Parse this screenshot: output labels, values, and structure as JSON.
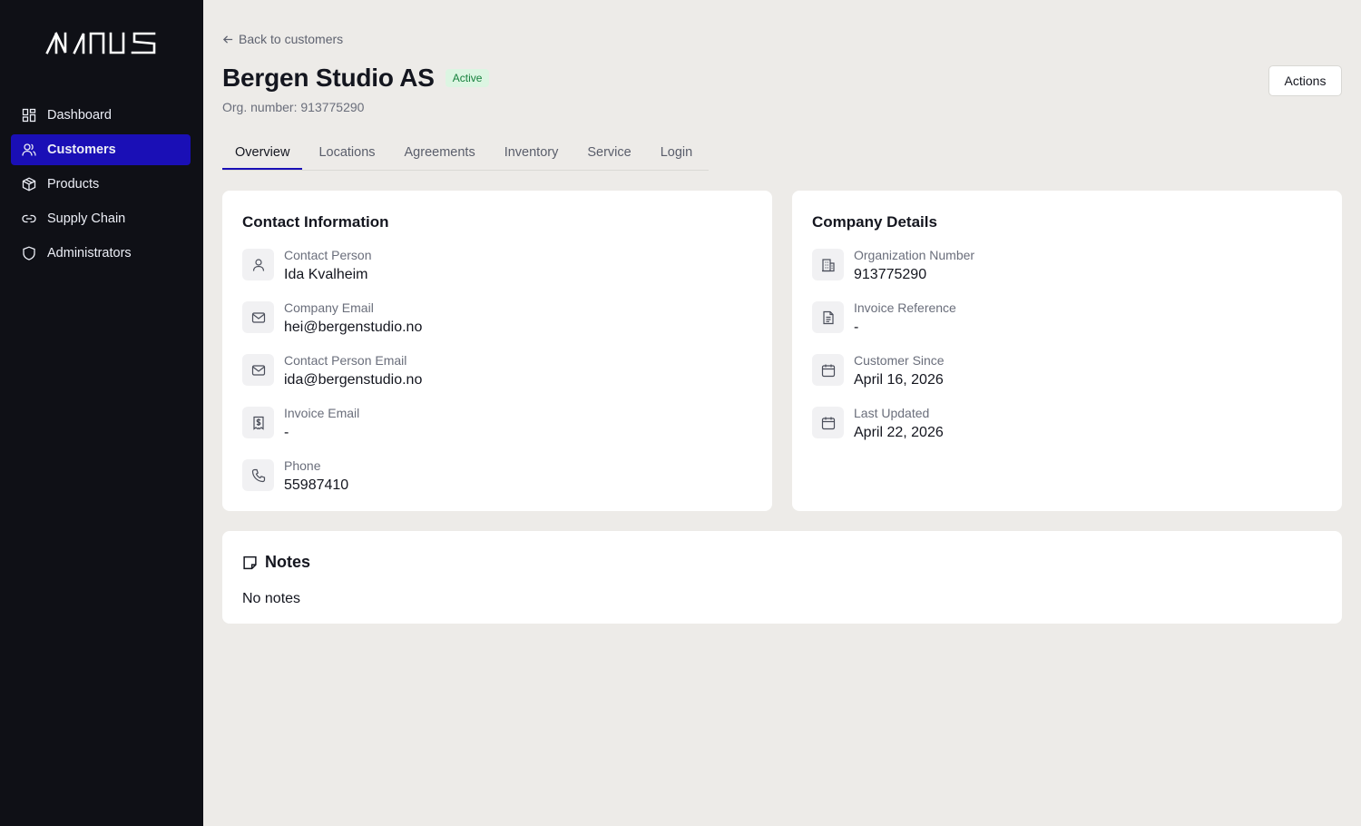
{
  "brand": {
    "logo_text": "MINUS"
  },
  "sidebar": {
    "items": [
      {
        "label": "Dashboard",
        "icon": "dashboard-icon",
        "active": false
      },
      {
        "label": "Customers",
        "icon": "users-icon",
        "active": true
      },
      {
        "label": "Products",
        "icon": "box-icon",
        "active": false
      },
      {
        "label": "Supply Chain",
        "icon": "link-icon",
        "active": false
      },
      {
        "label": "Administrators",
        "icon": "shield-icon",
        "active": false
      }
    ]
  },
  "header": {
    "back_label": "Back to customers",
    "title": "Bergen Studio AS",
    "status": "Active",
    "org_line": "Org. number: 913775290",
    "actions_label": "Actions"
  },
  "tabs": [
    {
      "label": "Overview",
      "active": true
    },
    {
      "label": "Locations",
      "active": false
    },
    {
      "label": "Agreements",
      "active": false
    },
    {
      "label": "Inventory",
      "active": false
    },
    {
      "label": "Service",
      "active": false
    },
    {
      "label": "Login",
      "active": false
    }
  ],
  "contact": {
    "title": "Contact Information",
    "fields": [
      {
        "label": "Contact Person",
        "value": "Ida Kvalheim",
        "icon": "user-icon"
      },
      {
        "label": "Company Email",
        "value": "hei@bergenstudio.no",
        "icon": "mail-icon"
      },
      {
        "label": "Contact Person Email",
        "value": "ida@bergenstudio.no",
        "icon": "mail-icon"
      },
      {
        "label": "Invoice Email",
        "value": "-",
        "icon": "invoice-icon"
      },
      {
        "label": "Phone",
        "value": "55987410",
        "icon": "phone-icon"
      }
    ]
  },
  "company": {
    "title": "Company Details",
    "fields": [
      {
        "label": "Organization Number",
        "value": "913775290",
        "icon": "building-icon"
      },
      {
        "label": "Invoice Reference",
        "value": "-",
        "icon": "document-icon"
      },
      {
        "label": "Customer Since",
        "value": "April 16, 2026",
        "icon": "calendar-icon"
      },
      {
        "label": "Last Updated",
        "value": "April 22, 2026",
        "icon": "calendar-icon"
      }
    ]
  },
  "notes": {
    "title": "Notes",
    "empty_text": "No notes"
  },
  "colors": {
    "accent": "#1a0fb6",
    "sidebar_bg": "#0f1016",
    "page_bg": "#edebe8",
    "badge_bg": "#dcf5e2",
    "badge_text": "#17803d"
  }
}
